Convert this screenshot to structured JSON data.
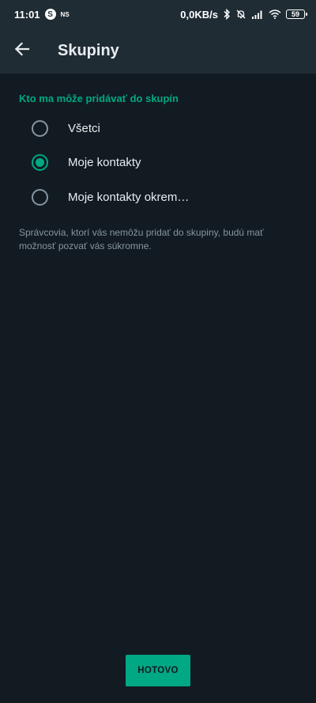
{
  "status_bar": {
    "time": "11:01",
    "app_badge": "S",
    "ns_tag": "NS",
    "net_speed": "0,0KB/s",
    "battery": "59"
  },
  "toolbar": {
    "back_icon": "arrow-left-icon",
    "title": "Skupiny"
  },
  "section": {
    "header": "Kto ma môže pridávať do skupín",
    "options": [
      {
        "label": "Všetci",
        "selected": false
      },
      {
        "label": "Moje kontakty",
        "selected": true
      },
      {
        "label": "Moje kontakty okrem…",
        "selected": false
      }
    ],
    "footnote": "Správcovia, ktorí vás nemôžu pridať do skupiny, budú mať možnosť pozvať vás súkromne."
  },
  "done_button": {
    "label": "HOTOVO"
  },
  "colors": {
    "background": "#121b22",
    "bar": "#1f2c34",
    "accent": "#00a884",
    "secondary_text": "#8696a0"
  }
}
